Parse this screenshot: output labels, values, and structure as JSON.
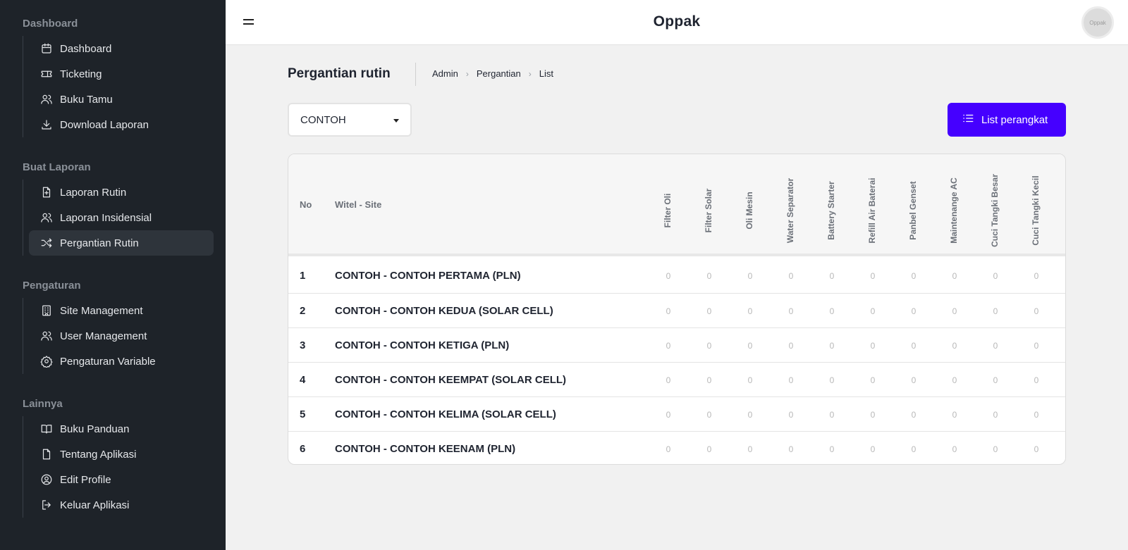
{
  "header": {
    "title": "Oppak",
    "avatar_text": "Oppak"
  },
  "sidebar": {
    "sections": [
      {
        "title": "Dashboard",
        "items": [
          {
            "label": "Dashboard",
            "icon": "calendar-icon"
          },
          {
            "label": "Ticketing",
            "icon": "ticket-icon"
          },
          {
            "label": "Buku Tamu",
            "icon": "users-icon"
          },
          {
            "label": "Download Laporan",
            "icon": "download-icon"
          }
        ]
      },
      {
        "title": "Buat Laporan",
        "items": [
          {
            "label": "Laporan Rutin",
            "icon": "file-plus-icon"
          },
          {
            "label": "Laporan Insidensial",
            "icon": "users-icon"
          },
          {
            "label": "Pergantian Rutin",
            "icon": "shuffle-icon",
            "active": true
          }
        ]
      },
      {
        "title": "Pengaturan",
        "items": [
          {
            "label": "Site Management",
            "icon": "building-icon"
          },
          {
            "label": "User Management",
            "icon": "users-icon"
          },
          {
            "label": "Pengaturan Variable",
            "icon": "gear-icon"
          }
        ]
      },
      {
        "title": "Lainnya",
        "items": [
          {
            "label": "Buku Panduan",
            "icon": "book-icon"
          },
          {
            "label": "Tentang Aplikasi",
            "icon": "file-icon"
          },
          {
            "label": "Edit Profile",
            "icon": "user-circle-icon"
          },
          {
            "label": "Keluar Aplikasi",
            "icon": "logout-icon"
          }
        ]
      }
    ]
  },
  "page": {
    "title": "Pergantian rutin",
    "breadcrumb": [
      "Admin",
      "Pergantian",
      "List"
    ],
    "select_value": "CONTOH",
    "list_button": "List perangkat"
  },
  "table": {
    "headers": {
      "no": "No",
      "site": "Witel - Site",
      "columns": [
        "Filter Oli",
        "Filter Solar",
        "Oli Mesin",
        "Water Separator",
        "Battery Starter",
        "Refill Air Baterai",
        "Panbel Genset",
        "Maintenange AC",
        "Cuci Tangki Besar",
        "Cuci Tangki Kecil"
      ]
    },
    "rows": [
      {
        "no": "1",
        "site": "CONTOH - CONTOH PERTAMA (PLN)",
        "values": [
          "0",
          "0",
          "0",
          "0",
          "0",
          "0",
          "0",
          "0",
          "0",
          "0"
        ]
      },
      {
        "no": "2",
        "site": "CONTOH - CONTOH KEDUA (SOLAR CELL)",
        "values": [
          "0",
          "0",
          "0",
          "0",
          "0",
          "0",
          "0",
          "0",
          "0",
          "0"
        ]
      },
      {
        "no": "3",
        "site": "CONTOH - CONTOH KETIGA (PLN)",
        "values": [
          "0",
          "0",
          "0",
          "0",
          "0",
          "0",
          "0",
          "0",
          "0",
          "0"
        ]
      },
      {
        "no": "4",
        "site": "CONTOH - CONTOH KEEMPAT (SOLAR CELL)",
        "values": [
          "0",
          "0",
          "0",
          "0",
          "0",
          "0",
          "0",
          "0",
          "0",
          "0"
        ]
      },
      {
        "no": "5",
        "site": "CONTOH - CONTOH KELIMA (SOLAR CELL)",
        "values": [
          "0",
          "0",
          "0",
          "0",
          "0",
          "0",
          "0",
          "0",
          "0",
          "0"
        ]
      },
      {
        "no": "6",
        "site": "CONTOH - CONTOH KEENAM (PLN)",
        "values": [
          "0",
          "0",
          "0",
          "0",
          "0",
          "0",
          "0",
          "0",
          "0",
          "0"
        ]
      }
    ]
  },
  "colors": {
    "accent": "#4500ff",
    "sidebar_bg": "#1e2329",
    "page_bg": "#f1f1f1"
  }
}
